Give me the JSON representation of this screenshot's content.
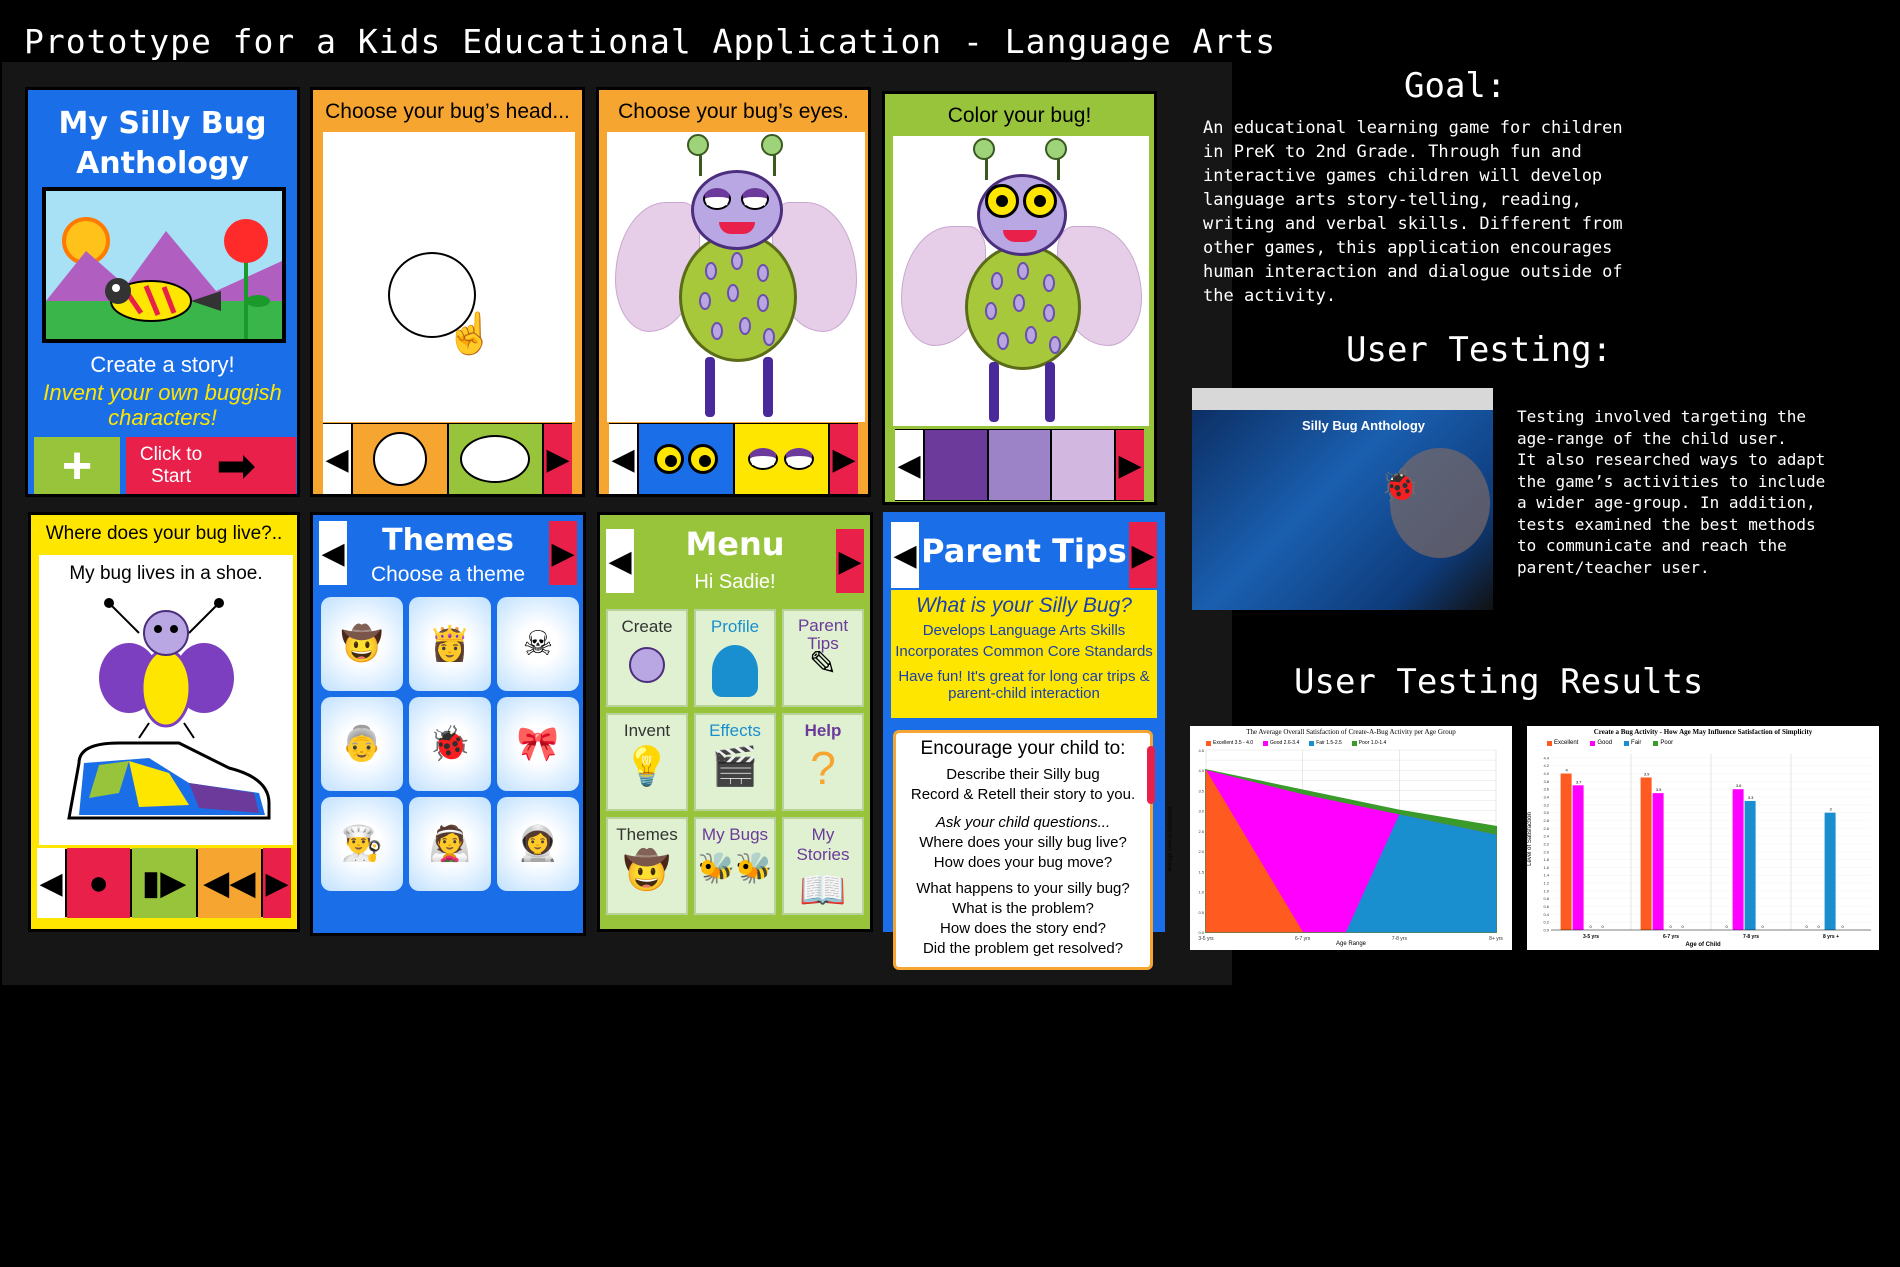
{
  "page_title": "Prototype for a Kids Educational Application - Language Arts",
  "colors": {
    "blue": "#1a6fe8",
    "orange": "#f7a531",
    "green": "#98c43c",
    "red": "#e8204a",
    "yellow": "#ffe600",
    "purple": "#6c3a9b"
  },
  "screens": {
    "home": {
      "title_line1": "My Silly Bug",
      "title_line2": "Anthology",
      "subtitle": "Create a story!",
      "tagline": "Invent your own buggish characters!",
      "plus_icon": "plus-icon",
      "start_label_1": "Click to",
      "start_label_2": "Start"
    },
    "head": {
      "title_a": "Choose",
      "title_b": "your bug’s head..."
    },
    "eyes": {
      "title_a": "Choose",
      "title_b": "your bug’s eyes."
    },
    "color": {
      "title_a": "Color",
      "title_b": "your bug!",
      "swatches": [
        "#6c3a9b",
        "#9c82c6",
        "#d2b8e0"
      ]
    },
    "live": {
      "title_a": "Where",
      "title_b": "does your bug live?..",
      "caption": "My bug lives in a shoe."
    },
    "themes": {
      "title": "Themes",
      "subtitle": "Choose a theme",
      "items": [
        "cowboy",
        "princess",
        "pirate",
        "grandma",
        "bug",
        "party",
        "chef",
        "bride",
        "astronaut"
      ]
    },
    "menu": {
      "title": "Menu",
      "greeting": "Hi Sadie!",
      "items": [
        {
          "label": "Create",
          "icon": "bug-icon"
        },
        {
          "label": "Profile",
          "icon": "person-icon"
        },
        {
          "label": "Parent\nTips",
          "icon": "pencil-icon"
        },
        {
          "label": "Invent",
          "icon": "lightbulb-icon"
        },
        {
          "label": "Effects",
          "icon": "clapper-icon"
        },
        {
          "label": "Help",
          "icon": "question-icon"
        },
        {
          "label": "Themes",
          "icon": "cowboy-bug-icon"
        },
        {
          "label": "My Bugs",
          "icon": "bees-icon"
        },
        {
          "label": "My Stories",
          "icon": "book-icon"
        }
      ]
    },
    "parent_tips": {
      "title": "Parent Tips",
      "question": "What is your Silly Bug?",
      "line1": "Develops Language Arts Skills",
      "line2": "Incorporates Common Core Standards",
      "line3": "Have fun! It's great for long car trips &",
      "line4": "parent-child interaction",
      "encourage": "Encourage your child to:",
      "e1": "Describe their Silly bug",
      "e2": "Record & Retell their story to you.",
      "ask": "Ask  your child questions...",
      "q1": "Where does your silly bug live?",
      "q2": "How does your bug move?",
      "q3": "What happens to your silly bug?",
      "q4": "What is the problem?",
      "q5": "How does the story end?",
      "q6": "Did the problem get resolved?"
    }
  },
  "goal": {
    "heading": "Goal:",
    "text": "An educational learning game for children\nin PreK to 2nd Grade. Through fun and\ninteractive games children will develop\nlanguage arts story-telling, reading,\nwriting and verbal skills. Different from\nother games, this application encourages\nhuman interaction and dialogue outside of\nthe activity."
  },
  "user_testing": {
    "heading": "User Testing:",
    "photo_caption": "Silly Bug Anthology",
    "text": "Testing involved targeting the\nage-range of the child user.\nIt also researched ways to adapt\nthe game’s activities to include\na wider age-group. In addition,\ntests examined the best methods\nto communicate and reach the\nparent/teacher user."
  },
  "results": {
    "heading": "User Testing Results"
  },
  "chart_data": [
    {
      "type": "area",
      "title": "The Average Overall Satisfaction of Create-A-Bug Activity per Age Group",
      "xlabel": "Age Range",
      "ylabel": "Average Level of Satisfaction",
      "categories": [
        "3-5 yrs",
        "6-7 yrs",
        "7-8 yrs",
        "8+ yrs"
      ],
      "ylim": [
        0,
        4.5
      ],
      "legend": "top",
      "series": [
        {
          "name": "Excellent 3.5 - 4.0",
          "color": "#ff5a1f",
          "values": [
            4.0,
            0,
            0,
            0
          ]
        },
        {
          "name": "Good 2.6-3.4",
          "color": "#ff00ff",
          "values": [
            4.0,
            3.4,
            2.9,
            2.4
          ]
        },
        {
          "name": "Fair 1.5-2.5",
          "color": "#1a8fd0",
          "values": [
            0,
            0,
            2.9,
            2.4
          ]
        },
        {
          "name": "Poor 1.0-1.4",
          "color": "#3a9a2a",
          "values": [
            4.0,
            3.5,
            3.0,
            2.6
          ]
        }
      ]
    },
    {
      "type": "bar",
      "title": "Create a Bug Activity - How Age May Influence Satisfaction of Simplicity",
      "xlabel": "Age of Child",
      "ylabel": "Level of Satisfaction",
      "categories": [
        "3-5 yrs",
        "6-7 yrs",
        "7-8 yrs",
        "8 yrs +"
      ],
      "ylim": [
        0,
        4.5
      ],
      "legend": "top",
      "series": [
        {
          "name": "Excellent",
          "color": "#ff5a1f",
          "values": [
            4,
            3.9,
            0,
            0
          ]
        },
        {
          "name": "Good",
          "color": "#ff00ff",
          "values": [
            3.7,
            3.5,
            3.6,
            0
          ]
        },
        {
          "name": "Fair",
          "color": "#1a8fd0",
          "values": [
            0,
            0,
            3.3,
            3
          ]
        },
        {
          "name": "Poor",
          "color": "#3a9a2a",
          "values": [
            0,
            0,
            0,
            0
          ]
        }
      ]
    }
  ]
}
